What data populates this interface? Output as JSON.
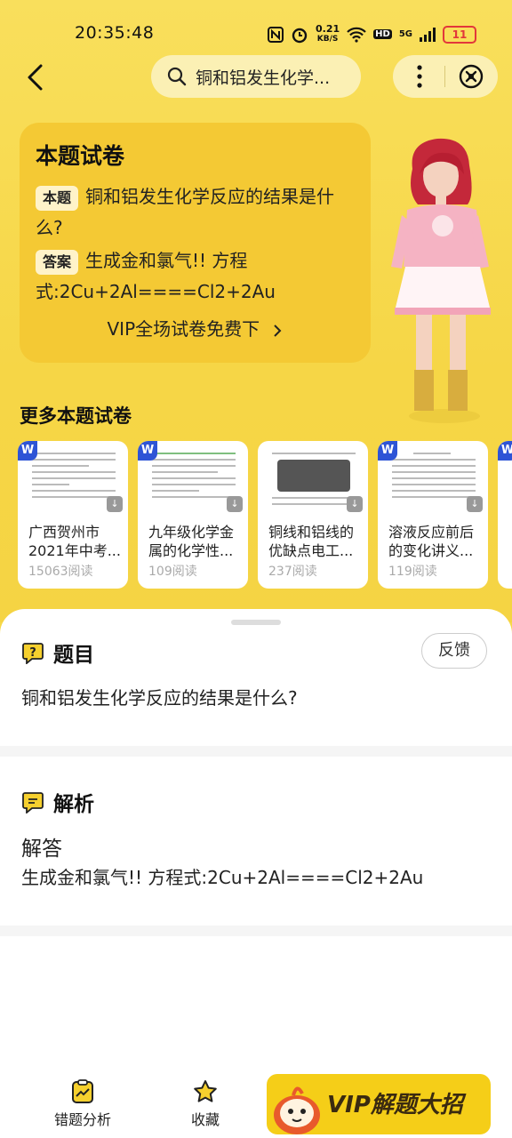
{
  "status_bar": {
    "time": "20:35:48",
    "net_speed": "0.21",
    "net_unit": "KB/S",
    "hd": "HD",
    "signal": "5G",
    "battery": "11"
  },
  "header": {
    "search_query": "铜和铝发生化学..."
  },
  "paper_card": {
    "title": "本题试卷",
    "question_tag": "本题",
    "question": "铜和铝发生化学反应的结果是什么?",
    "answer_tag": "答案",
    "answer": "生成金和氯气!! 方程式:2Cu+2Al====Cl2+2Au",
    "vip_link": "VIP全场试卷免费下"
  },
  "more_papers": {
    "title": "更多本题试卷",
    "items": [
      {
        "badge": "W",
        "title": "广西贺州市2021年中考...",
        "reads": "15063阅读"
      },
      {
        "badge": "W",
        "title": "九年级化学金属的化学性...",
        "reads": "109阅读"
      },
      {
        "badge": "",
        "title": "铜线和铝线的优缺点电工...",
        "reads": "237阅读"
      },
      {
        "badge": "W",
        "title": "溶液反应前后的变化讲义...",
        "reads": "119阅读"
      }
    ]
  },
  "question_section": {
    "label": "题目",
    "feedback": "反馈",
    "text": "铜和铝发生化学反应的结果是什么?"
  },
  "analysis_section": {
    "label": "解析",
    "subtitle": "解答",
    "text": "生成金和氯气!! 方程式:2Cu+2Al====Cl2+2Au"
  },
  "bottom_bar": {
    "mistake_analysis": "错题分析",
    "favorite": "收藏",
    "vip_button": "VIP解题大招"
  },
  "colors": {
    "brand_yellow": "#f7d94a",
    "card_yellow": "#f4c934",
    "word_badge": "#2e54d6",
    "battery_red": "#e2373a"
  }
}
